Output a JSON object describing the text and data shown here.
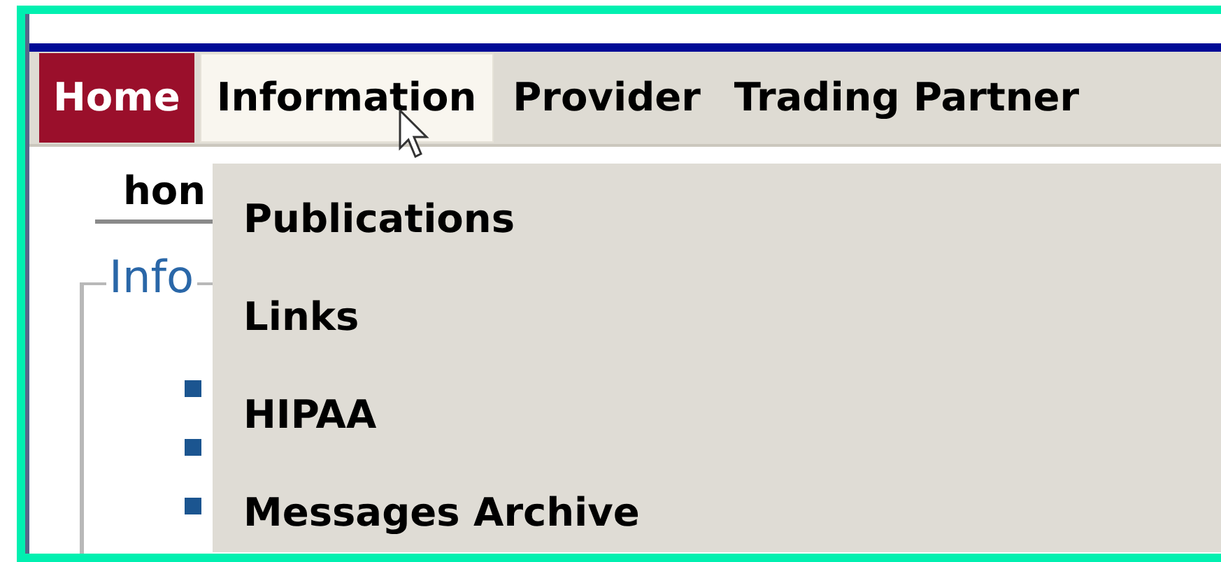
{
  "nav": {
    "tabs": [
      {
        "label": "Home",
        "selected": true,
        "expanded": false
      },
      {
        "label": "Information",
        "selected": false,
        "expanded": true
      },
      {
        "label": "Provider",
        "selected": false,
        "expanded": false
      },
      {
        "label": "Trading Partner",
        "selected": false,
        "expanded": false
      }
    ]
  },
  "dropdown": {
    "items": [
      "Publications",
      "Links",
      "HIPAA",
      "Messages Archive"
    ]
  },
  "content": {
    "page_tab": "hon",
    "section_legend": "Info"
  }
}
